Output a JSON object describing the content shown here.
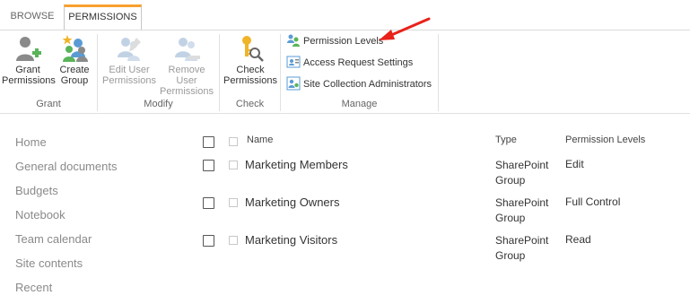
{
  "tabs": {
    "browse": "BROWSE",
    "permissions": "PERMISSIONS"
  },
  "ribbon": {
    "grant": {
      "label": "Grant",
      "grant_permissions": {
        "line1": "Grant",
        "line2": "Permissions"
      },
      "create_group": {
        "line1": "Create",
        "line2": "Group"
      }
    },
    "modify": {
      "label": "Modify",
      "edit_user_permissions": {
        "line1": "Edit User",
        "line2": "Permissions"
      },
      "remove_user_permissions": {
        "line1": "Remove User",
        "line2": "Permissions"
      }
    },
    "check": {
      "label": "Check",
      "check_permissions": {
        "line1": "Check",
        "line2": "Permissions"
      }
    },
    "manage": {
      "label": "Manage",
      "permission_levels": "Permission Levels",
      "access_request_settings": "Access Request Settings",
      "site_collection_administrators": "Site Collection Administrators"
    }
  },
  "nav": {
    "items": [
      "Home",
      "General documents",
      "Budgets",
      "Notebook",
      "Team calendar",
      "Site contents",
      "Recent"
    ]
  },
  "list": {
    "columns": {
      "name": "Name",
      "type": "Type",
      "permission_levels": "Permission Levels"
    },
    "rows": [
      {
        "name": "Marketing Members",
        "type_line1": "SharePoint",
        "type_line2": "Group",
        "level": "Edit"
      },
      {
        "name": "Marketing Owners",
        "type_line1": "SharePoint",
        "type_line2": "Group",
        "level": "Full Control"
      },
      {
        "name": "Marketing Visitors",
        "type_line1": "SharePoint",
        "type_line2": "Group",
        "level": "Read"
      }
    ]
  },
  "colors": {
    "accent_tab": "#f7a02e",
    "arrow": "#e8221b",
    "icon_people": "#5a9bd5",
    "icon_person": "#8a8a8a",
    "icon_green": "#5ab45a",
    "icon_key": "#f0b429"
  },
  "icons": {
    "grant_permissions": "person-with-plus-icon",
    "create_group": "group-with-star-icon",
    "edit_user_permissions": "people-edit-icon",
    "remove_user_permissions": "people-remove-icon",
    "check_permissions": "key-magnifier-icon",
    "permission_levels": "people-icon",
    "access_request_settings": "request-settings-icon",
    "site_collection_administrators": "admin-icon"
  }
}
